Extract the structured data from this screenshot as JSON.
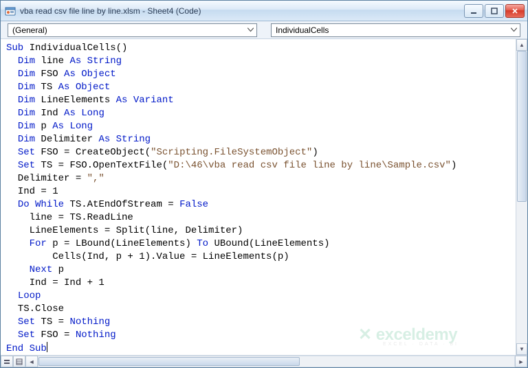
{
  "window": {
    "title": "vba read csv file line by line.xlsm - Sheet4 (Code)"
  },
  "dropdowns": {
    "left": "(General)",
    "right": "IndividualCells"
  },
  "code": {
    "tokens": [
      [
        [
          "kw",
          "Sub"
        ],
        [
          "",
          " IndividualCells()"
        ]
      ],
      [
        [
          "",
          "  "
        ],
        [
          "kw",
          "Dim"
        ],
        [
          "",
          " line "
        ],
        [
          "kw",
          "As String"
        ]
      ],
      [
        [
          "",
          "  "
        ],
        [
          "kw",
          "Dim"
        ],
        [
          "",
          " FSO "
        ],
        [
          "kw",
          "As Object"
        ]
      ],
      [
        [
          "",
          "  "
        ],
        [
          "kw",
          "Dim"
        ],
        [
          "",
          " TS "
        ],
        [
          "kw",
          "As Object"
        ]
      ],
      [
        [
          "",
          "  "
        ],
        [
          "kw",
          "Dim"
        ],
        [
          "",
          " LineElements "
        ],
        [
          "kw",
          "As Variant"
        ]
      ],
      [
        [
          "",
          "  "
        ],
        [
          "kw",
          "Dim"
        ],
        [
          "",
          " Ind "
        ],
        [
          "kw",
          "As Long"
        ]
      ],
      [
        [
          "",
          "  "
        ],
        [
          "kw",
          "Dim"
        ],
        [
          "",
          " p "
        ],
        [
          "kw",
          "As Long"
        ]
      ],
      [
        [
          "",
          "  "
        ],
        [
          "kw",
          "Dim"
        ],
        [
          "",
          " Delimiter "
        ],
        [
          "kw",
          "As String"
        ]
      ],
      [
        [
          "",
          "  "
        ],
        [
          "kw",
          "Set"
        ],
        [
          "",
          " FSO = CreateObject("
        ],
        [
          "str",
          "\"Scripting.FileSystemObject\""
        ],
        [
          "",
          ")"
        ]
      ],
      [
        [
          "",
          "  "
        ],
        [
          "kw",
          "Set"
        ],
        [
          "",
          " TS = FSO.OpenTextFile("
        ],
        [
          "str",
          "\"D:\\46\\vba read csv file line by line\\Sample.csv\""
        ],
        [
          "",
          ")"
        ]
      ],
      [
        [
          "",
          "  Delimiter = "
        ],
        [
          "str",
          "\",\""
        ]
      ],
      [
        [
          "",
          "  Ind = 1"
        ]
      ],
      [
        [
          "",
          "  "
        ],
        [
          "kw",
          "Do While"
        ],
        [
          "",
          " TS.AtEndOfStream = "
        ],
        [
          "kw",
          "False"
        ]
      ],
      [
        [
          "",
          "    line = TS.ReadLine"
        ]
      ],
      [
        [
          "",
          "    LineElements = Split(line, Delimiter)"
        ]
      ],
      [
        [
          "",
          "    "
        ],
        [
          "kw",
          "For"
        ],
        [
          "",
          " p = LBound(LineElements) "
        ],
        [
          "kw",
          "To"
        ],
        [
          "",
          " UBound(LineElements)"
        ]
      ],
      [
        [
          "",
          "        Cells(Ind, p + 1).Value = LineElements(p)"
        ]
      ],
      [
        [
          "",
          "    "
        ],
        [
          "kw",
          "Next"
        ],
        [
          "",
          " p"
        ]
      ],
      [
        [
          "",
          "    Ind = Ind + 1"
        ]
      ],
      [
        [
          "",
          "  "
        ],
        [
          "kw",
          "Loop"
        ]
      ],
      [
        [
          "",
          "  TS.Close"
        ]
      ],
      [
        [
          "",
          "  "
        ],
        [
          "kw",
          "Set"
        ],
        [
          "",
          " TS = "
        ],
        [
          "kw",
          "Nothing"
        ]
      ],
      [
        [
          "",
          "  "
        ],
        [
          "kw",
          "Set"
        ],
        [
          "",
          " FSO = "
        ],
        [
          "kw",
          "Nothing"
        ]
      ],
      [
        [
          "kw",
          "End Sub"
        ]
      ]
    ]
  },
  "watermark": {
    "brand": "exceldemy",
    "tagline": "EXCEL · DATA · BI"
  }
}
